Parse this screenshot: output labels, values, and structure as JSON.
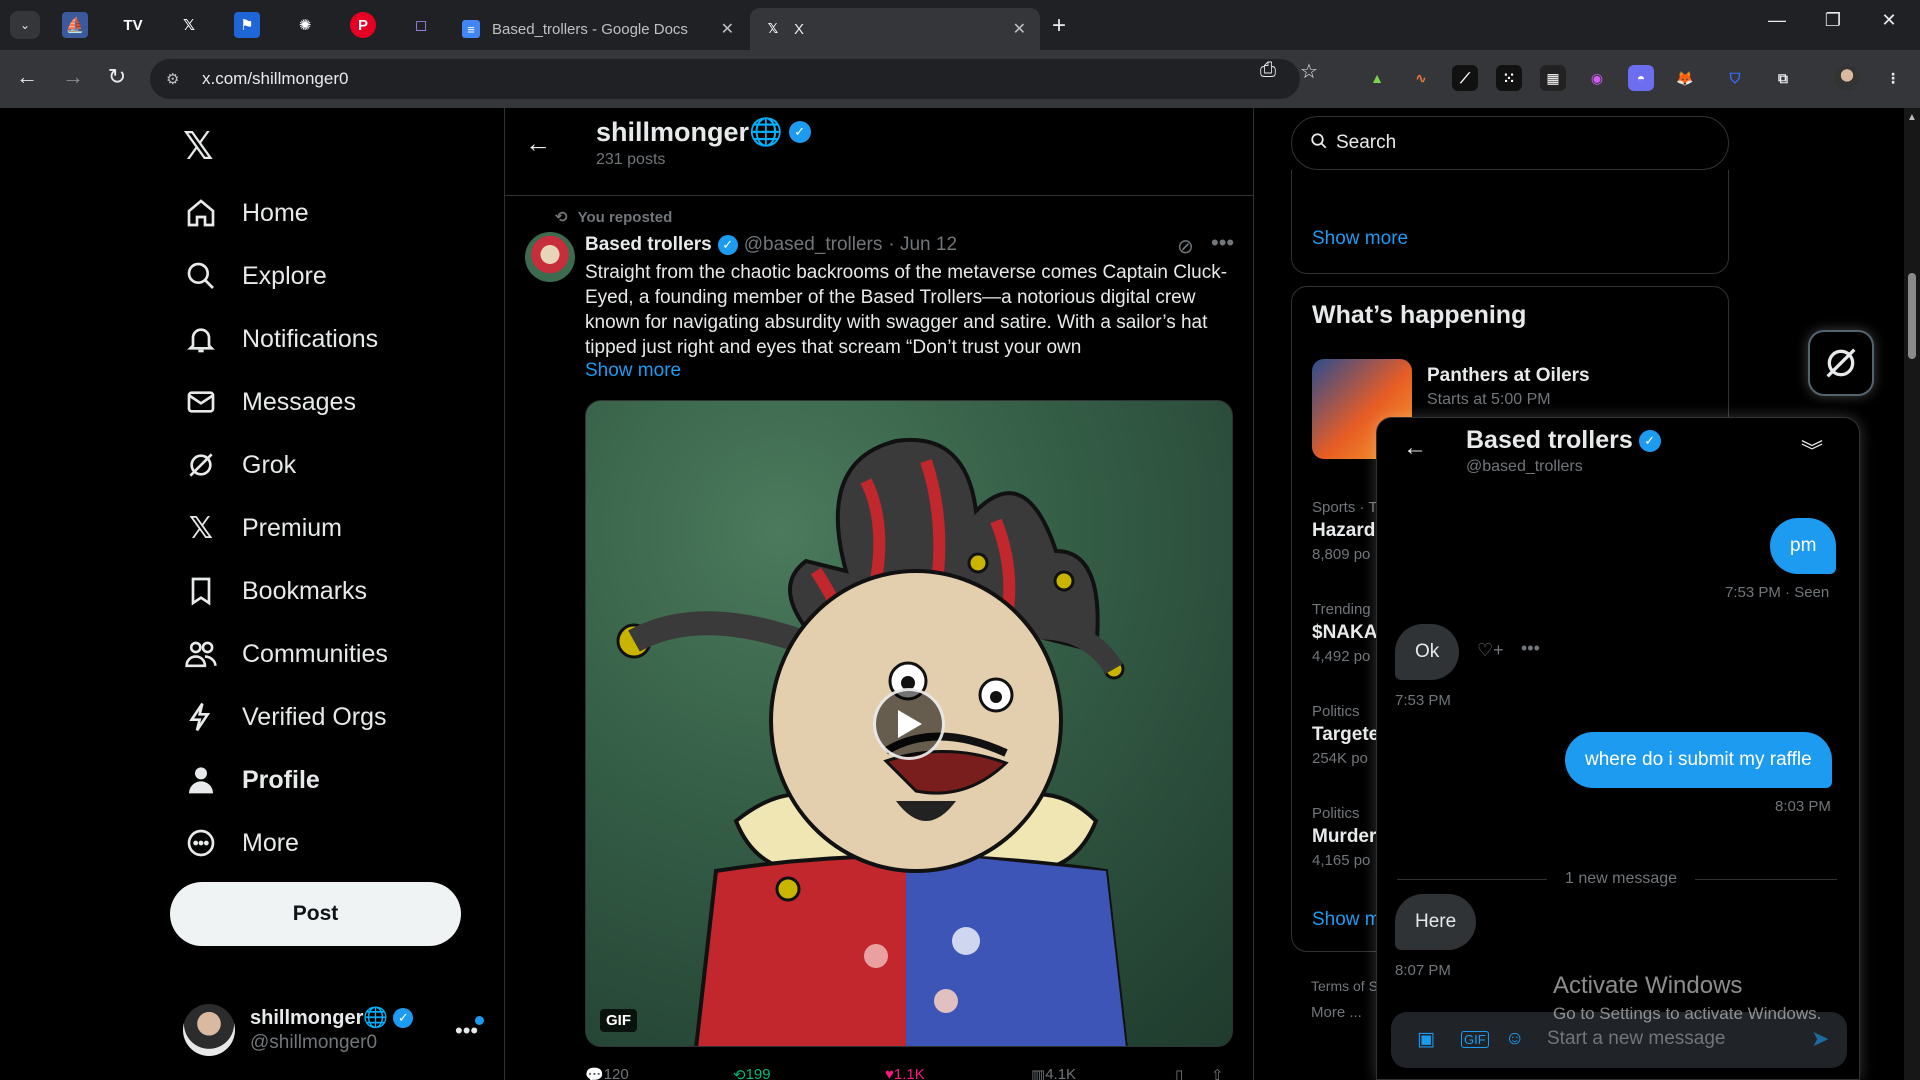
{
  "browser": {
    "tabs": [
      {
        "label": "Based_trollers - Google Docs",
        "active": false
      },
      {
        "label": "X",
        "active": true
      }
    ],
    "url": "x.com/shillmonger0"
  },
  "nav": {
    "items": [
      {
        "label": "Home",
        "icon": "home-icon"
      },
      {
        "label": "Explore",
        "icon": "search-icon"
      },
      {
        "label": "Notifications",
        "icon": "bell-icon"
      },
      {
        "label": "Messages",
        "icon": "mail-icon"
      },
      {
        "label": "Grok",
        "icon": "grok-icon"
      },
      {
        "label": "Premium",
        "icon": "x-icon"
      },
      {
        "label": "Bookmarks",
        "icon": "bookmark-icon"
      },
      {
        "label": "Communities",
        "icon": "people-icon"
      },
      {
        "label": "Verified Orgs",
        "icon": "lightning-icon"
      },
      {
        "label": "Profile",
        "icon": "person-icon"
      },
      {
        "label": "More",
        "icon": "more-circle-icon"
      }
    ],
    "post_label": "Post",
    "account": {
      "name": "shillmonger🌐",
      "handle": "@shillmonger0"
    }
  },
  "profile_header": {
    "name": "shillmonger🌐",
    "posts": "231 posts"
  },
  "tweet": {
    "repost_label": "You reposted",
    "author": "Based trollers",
    "handle": "@based_trollers",
    "date": "· Jun 12",
    "text": "Straight from the chaotic backrooms of the metaverse comes Captain Cluck-Eyed, a founding member of the Based Trollers—a notorious digital crew known for navigating absurdity with swagger and satire. With a sailor’s hat tipped just right and eyes that scream “Don’t trust your own",
    "show_more": "Show more",
    "media_badge": "GIF",
    "stats": {
      "replies": "120",
      "reposts": "199",
      "likes": "1.1K",
      "views": "4.1K"
    }
  },
  "right": {
    "search_placeholder": "Search",
    "show_more_top": "Show more",
    "whats_happening": "What’s happening",
    "event": {
      "title": "Panthers at Oilers",
      "sub": "Starts at 5:00 PM"
    },
    "trends": [
      {
        "category": "Sports · T",
        "title": "Hazard",
        "count": "8,809 po"
      },
      {
        "category": "Trending",
        "title": "$NAKA",
        "count": "4,492 po"
      },
      {
        "category": "Politics",
        "title": "Targete",
        "count": "254K po"
      },
      {
        "category": "Politics",
        "title": "Murder",
        "count": "4,165 po"
      }
    ],
    "show_more_bottom": "Show m",
    "footer1": "Terms of S",
    "footer2": "More ..."
  },
  "dm": {
    "name": "Based trollers",
    "handle": "@based_trollers",
    "messages": [
      {
        "from": "me",
        "text": "pm",
        "meta": "7:53 PM · Seen"
      },
      {
        "from": "them",
        "text": "Ok",
        "meta": "7:53 PM"
      },
      {
        "from": "me",
        "text": "where do i submit my raffle",
        "meta": "8:03 PM"
      },
      {
        "from": "them",
        "text": "Here",
        "meta": "8:07 PM"
      }
    ],
    "new_message_divider": "1 new message",
    "composer_placeholder": "Start a new message"
  },
  "os_watermark": {
    "line1": "Activate Windows",
    "line2": "Go to Settings to activate Windows."
  },
  "colors": {
    "accent": "#1d9bf0",
    "bg": "#000000",
    "border": "#2f3336",
    "muted": "#71767b"
  }
}
